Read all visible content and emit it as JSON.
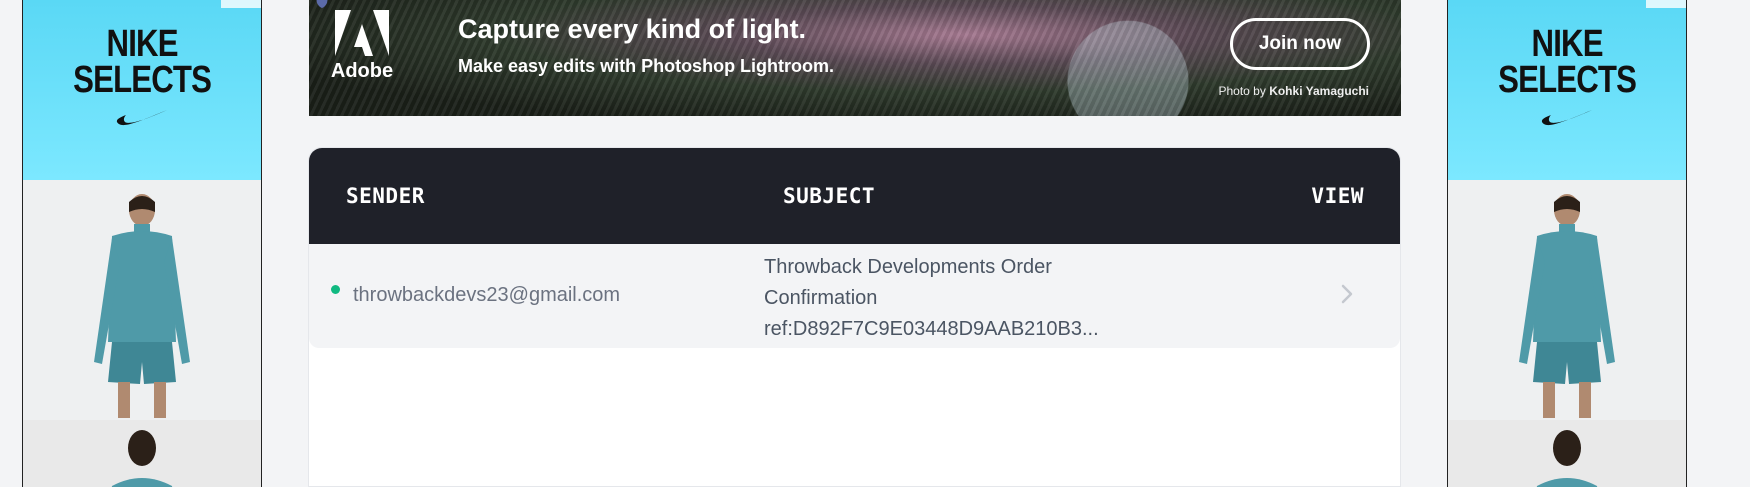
{
  "left_ad": {
    "headline_line1": "NIKE",
    "headline_line2": "SELECTS",
    "icon": "nike-swoosh-icon"
  },
  "right_ad": {
    "headline_line1": "NIKE",
    "headline_line2": "SELECTS",
    "icon": "nike-swoosh-icon"
  },
  "banner": {
    "brand": "Adobe",
    "headline": "Capture every kind of light.",
    "subline": "Make easy edits with Photoshop Lightroom.",
    "cta": "Join now",
    "credit_prefix": "Photo by",
    "credit_name": "Kohki Yamaguchi"
  },
  "inbox": {
    "columns": {
      "sender": "SENDER",
      "subject": "SUBJECT",
      "view": "VIEW"
    },
    "rows": [
      {
        "unread": true,
        "sender": "throwbackdevs23@gmail.com",
        "subject": "Throwback Developments Order Confirmation ref:D892F7C9E03448D9AAB210B3..."
      }
    ]
  },
  "colors": {
    "header_bg": "#1f2129",
    "unread_dot": "#10b981",
    "ad_blue": "#7ce8ff"
  }
}
